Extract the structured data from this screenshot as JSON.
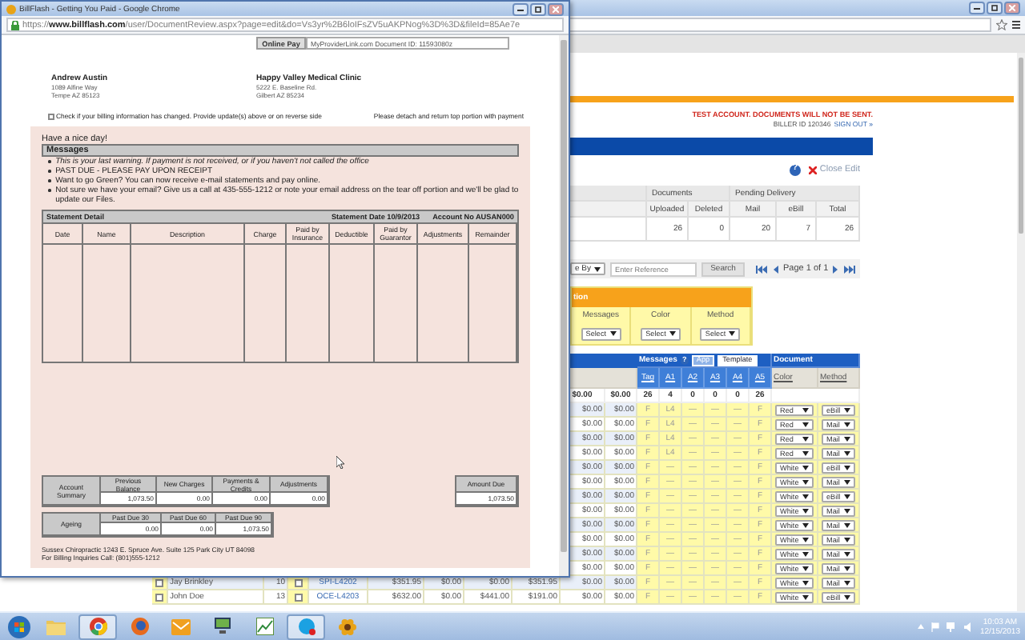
{
  "popup": {
    "title": "BillFlash - Getting You Paid - Google Chrome",
    "url": "https://**www.billflash.com**/user/DocumentReview.aspx?page=edit&do=Vs3yr%2B6loIFsZV5uAKPNog%3D%3D&fileId=85Ae7e",
    "online_pay": "Online Pay",
    "document_link": "MyProviderLink.com  Document ID: 11593080z",
    "patient": {
      "name": "Andrew Austin",
      "lines": [
        "1089 Alfine Way",
        "Tempe AZ 85123"
      ]
    },
    "clinic": {
      "name": "Happy Valley Medical Clinic",
      "lines": [
        "5222 E. Baseline Rd.",
        "Gilbert AZ 85234"
      ]
    },
    "change_check": {
      "checked": false,
      "label": "Check if your billing information has changed. Provide update(s) above or on reverse side"
    },
    "detach_note": "Please detach and return top portion with payment",
    "greeting": "Have a nice day!",
    "messages_title": "Messages",
    "messages": [
      {
        "text": "This is your last warning. If payment is not received, or if you haven't not called the office",
        "italic": true
      },
      {
        "text": "PAST DUE - PLEASE PAY UPON RECEIPT",
        "italic": false
      },
      {
        "text": "Want to go Green? You can now receive e-mail statements and pay online.",
        "italic": false
      },
      {
        "text": "Not sure we have your email? Give us a call at 435-555-1212 or note your email address on the tear off portion and we'll be glad to update our Files.",
        "italic": false
      }
    ],
    "statement": {
      "title": "Statement Detail",
      "date": "Statement Date 10/9/2013",
      "account": "Account No AUSAN000",
      "columns": [
        "Date",
        "Name",
        "Description",
        "Charge",
        "Paid by Insurance",
        "Deductible",
        "Paid by Guarantor",
        "Adjustments",
        "Remainder"
      ]
    },
    "summary": {
      "label": "Account Summary",
      "items": [
        {
          "label": "Previous Balance",
          "value": "1,073.50"
        },
        {
          "label": "New Charges",
          "value": "0.00"
        },
        {
          "label": "Payments & Credits",
          "value": "0.00"
        },
        {
          "label": "Adjustments",
          "value": "0.00"
        }
      ]
    },
    "amount_due": {
      "label": "Amount Due",
      "value": "1,073.50"
    },
    "ageing": {
      "label": "Ageing",
      "items": [
        {
          "label": "Past Due 30",
          "value": "0.00"
        },
        {
          "label": "Past Due 60",
          "value": "0.00"
        },
        {
          "label": "Past Due 90",
          "value": "1,073.50"
        }
      ]
    },
    "footer": [
      "Sussex Chiropractic 1243 E. Spruce Ave. Suite 125 Park City UT 84098",
      "For Billing Inquiries Call: (801)555-1212"
    ]
  },
  "app": {
    "notice": "TEST ACCOUNT. DOCUMENTS WILL NOT BE SENT.",
    "biller": "BILLER ID 120346",
    "sign_out": "SIGN OUT »",
    "help": "?",
    "close_edit": "Close Edit",
    "stats": [
      {
        "label": "Documents",
        "columns": [
          {
            "label": "Uploaded",
            "value": "26"
          },
          {
            "label": "Deleted",
            "value": "0"
          }
        ]
      },
      {
        "label": "Pending Delivery",
        "columns": [
          {
            "label": "Mail",
            "value": "20"
          },
          {
            "label": "eBill",
            "value": "7"
          },
          {
            "label": "Total",
            "value": "26"
          }
        ]
      }
    ],
    "search": {
      "sort": "e By",
      "placeholder": "Enter Reference",
      "button": "Search",
      "page": "Page 1 of 1"
    },
    "filters": {
      "title": "tion",
      "fields": [
        {
          "label": "Messages",
          "value": "Select"
        },
        {
          "label": "Color",
          "value": "Select"
        },
        {
          "label": "Method",
          "value": "Select"
        }
      ]
    },
    "table": {
      "messages_group": "Messages",
      "help": "?",
      "tabs": [
        {
          "label": "App",
          "selected": true
        },
        {
          "label": "Template",
          "selected": false
        }
      ],
      "document_group": "Document",
      "columns": [
        "Tag",
        "A1",
        "A2",
        "A3",
        "A4",
        "A5",
        "Color",
        "Method"
      ],
      "totals": [
        "$0.00",
        "$0.00",
        "26",
        "4",
        "0",
        "0",
        "0",
        "26"
      ],
      "rows": [
        {
          "amounts": [
            "$0.00",
            "$0.00"
          ],
          "tags": [
            "F",
            "L4",
            "—",
            "—",
            "—",
            "F"
          ],
          "color_choice": "Red",
          "method": "eBill"
        },
        {
          "amounts": [
            "$0.00",
            "$0.00"
          ],
          "tags": [
            "F",
            "L4",
            "—",
            "—",
            "—",
            "F"
          ],
          "color_choice": "Red",
          "method": "Mail"
        },
        {
          "amounts": [
            "$0.00",
            "$0.00"
          ],
          "tags": [
            "F",
            "L4",
            "—",
            "—",
            "—",
            "F"
          ],
          "color_choice": "Red",
          "method": "Mail"
        },
        {
          "amounts": [
            "$0.00",
            "$0.00"
          ],
          "tags": [
            "F",
            "L4",
            "—",
            "—",
            "—",
            "F"
          ],
          "color_choice": "Red",
          "method": "Mail"
        },
        {
          "amounts": [
            "$0.00",
            "$0.00"
          ],
          "tags": [
            "F",
            "—",
            "—",
            "—",
            "—",
            "F"
          ],
          "color_choice": "White",
          "method": "eBill"
        },
        {
          "amounts": [
            "$0.00",
            "$0.00"
          ],
          "tags": [
            "F",
            "—",
            "—",
            "—",
            "—",
            "F"
          ],
          "color_choice": "White",
          "method": "Mail"
        },
        {
          "amounts": [
            "$0.00",
            "$0.00"
          ],
          "tags": [
            "F",
            "—",
            "—",
            "—",
            "—",
            "F"
          ],
          "color_choice": "White",
          "method": "eBill"
        },
        {
          "amounts": [
            "$0.00",
            "$0.00"
          ],
          "tags": [
            "F",
            "—",
            "—",
            "—",
            "—",
            "F"
          ],
          "color_choice": "White",
          "method": "Mail"
        },
        {
          "amounts": [
            "$0.00",
            "$0.00"
          ],
          "tags": [
            "F",
            "—",
            "—",
            "—",
            "—",
            "F"
          ],
          "color_choice": "White",
          "method": "Mail"
        },
        {
          "amounts": [
            "$0.00",
            "$0.00"
          ],
          "tags": [
            "F",
            "—",
            "—",
            "—",
            "—",
            "F"
          ],
          "color_choice": "White",
          "method": "Mail"
        },
        {
          "amounts": [
            "$0.00",
            "$0.00"
          ],
          "tags": [
            "F",
            "—",
            "—",
            "—",
            "—",
            "F"
          ],
          "color_choice": "White",
          "method": "Mail"
        },
        {
          "amounts": [
            "$0.00",
            "$0.00"
          ],
          "tags": [
            "F",
            "—",
            "—",
            "—",
            "—",
            "F"
          ],
          "color_choice": "White",
          "method": "Mail"
        },
        {
          "left": {
            "checked": false,
            "name": "Jay Brinkley",
            "count": "10",
            "hold": false,
            "doc": "SPI-L4202",
            "amounts": [
              "$351.95",
              "$0.00",
              "$0.00",
              "$351.95"
            ]
          },
          "amounts": [
            "$0.00",
            "$0.00"
          ],
          "tags": [
            "F",
            "—",
            "—",
            "—",
            "—",
            "F"
          ],
          "color_choice": "White",
          "method": "Mail"
        },
        {
          "left": {
            "checked": false,
            "name": "John Doe",
            "count": "13",
            "hold": false,
            "doc": "OCE-L4203",
            "amounts": [
              "$632.00",
              "$0.00",
              "$441.00",
              "$191.00"
            ]
          },
          "amounts": [
            "$0.00",
            "$0.00"
          ],
          "tags": [
            "F",
            "—",
            "—",
            "—",
            "—",
            "F"
          ],
          "color_choice": "White",
          "method": "eBill"
        }
      ]
    }
  },
  "taskbar": {
    "apps": [
      {
        "kind": "folder",
        "active": false
      },
      {
        "kind": "chrome",
        "active": true
      },
      {
        "kind": "firefox",
        "active": false
      },
      {
        "kind": "outlook",
        "active": false
      },
      {
        "kind": "remote",
        "active": false
      },
      {
        "kind": "chart",
        "active": false
      },
      {
        "kind": "skype",
        "active": true
      },
      {
        "kind": "flower",
        "active": false
      }
    ],
    "clock": {
      "time": "10:03 AM",
      "date": "12/15/2013"
    }
  }
}
